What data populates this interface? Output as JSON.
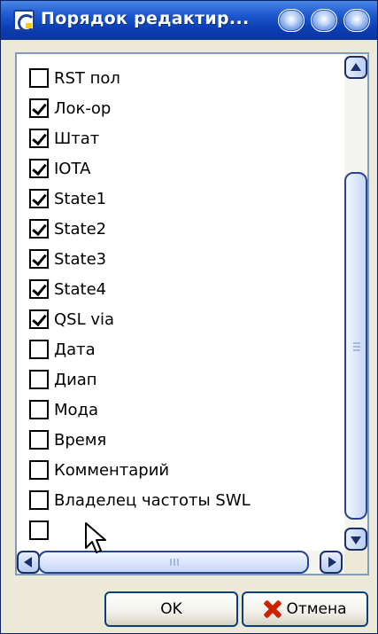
{
  "window": {
    "title": "Порядок редактир..."
  },
  "list": {
    "items": [
      {
        "label": "RST пол",
        "checked": false
      },
      {
        "label": "Лок-ор",
        "checked": true
      },
      {
        "label": "Штат",
        "checked": true
      },
      {
        "label": "IOTA",
        "checked": true
      },
      {
        "label": "State1",
        "checked": true
      },
      {
        "label": "State2",
        "checked": true
      },
      {
        "label": "State3",
        "checked": true
      },
      {
        "label": "State4",
        "checked": true
      },
      {
        "label": "QSL via",
        "checked": true
      },
      {
        "label": "Дата",
        "checked": false
      },
      {
        "label": "Диап",
        "checked": false
      },
      {
        "label": "Мода",
        "checked": false
      },
      {
        "label": "Время",
        "checked": false
      },
      {
        "label": "Комментарий",
        "checked": false
      },
      {
        "label": "Владелец частоты SWL",
        "checked": false
      },
      {
        "label": "",
        "checked": false
      }
    ]
  },
  "buttons": {
    "ok_label": "OK",
    "cancel_label": "Отмена"
  },
  "colors": {
    "titlebar": "#0b3fb5",
    "window_bg": "#ece9d8",
    "cancel_icon": "#cc2200"
  },
  "icons": {
    "app": "app-icon",
    "cancel": "x-icon"
  }
}
